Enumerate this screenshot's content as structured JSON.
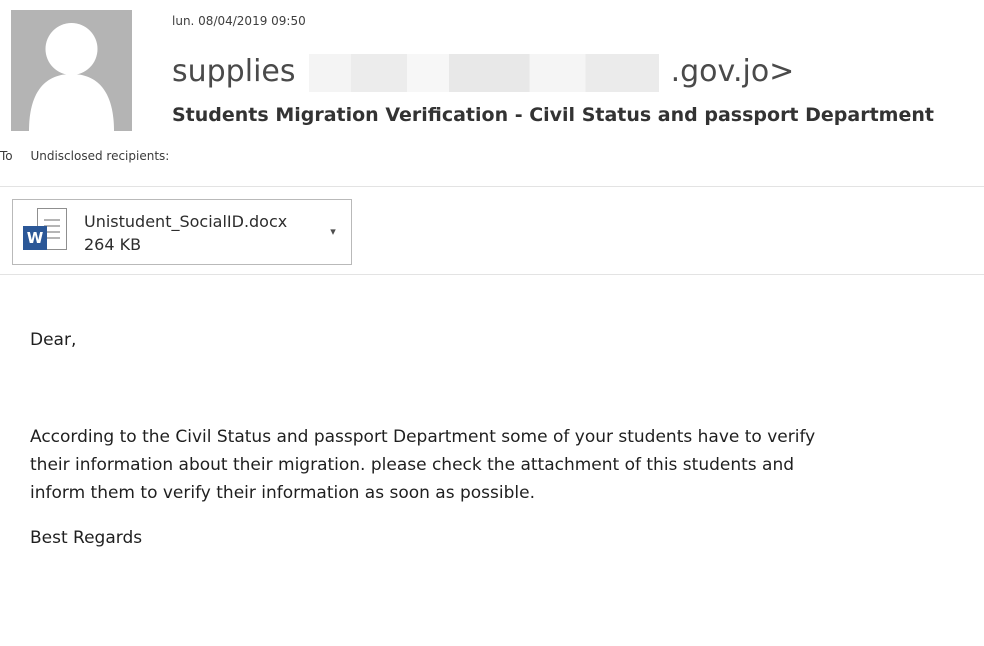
{
  "header": {
    "date": "lun. 08/04/2019 09:50",
    "sender": {
      "visible_name": "supplies",
      "visible_domain": ".gov.jo>"
    },
    "subject": "Students Migration Verification - Civil Status and passport Department",
    "to_label": "To",
    "recipients": "Undisclosed recipients:"
  },
  "attachment": {
    "icon": "word-document-icon",
    "filename": "Unistudent_SocialID.docx",
    "size": "264 KB"
  },
  "message": {
    "greeting": "Dear,",
    "paragraph": "According to the Civil Status and passport Department some of your students have to verify\ntheir information about their migration. please check the attachment of this students and\ninform them to verify their information as soon as possible.",
    "signoff": "Best Regards"
  },
  "colors": {
    "word_blue": "#2b5797",
    "avatar_gray": "#b4b4b4",
    "text_dark": "#222222"
  }
}
